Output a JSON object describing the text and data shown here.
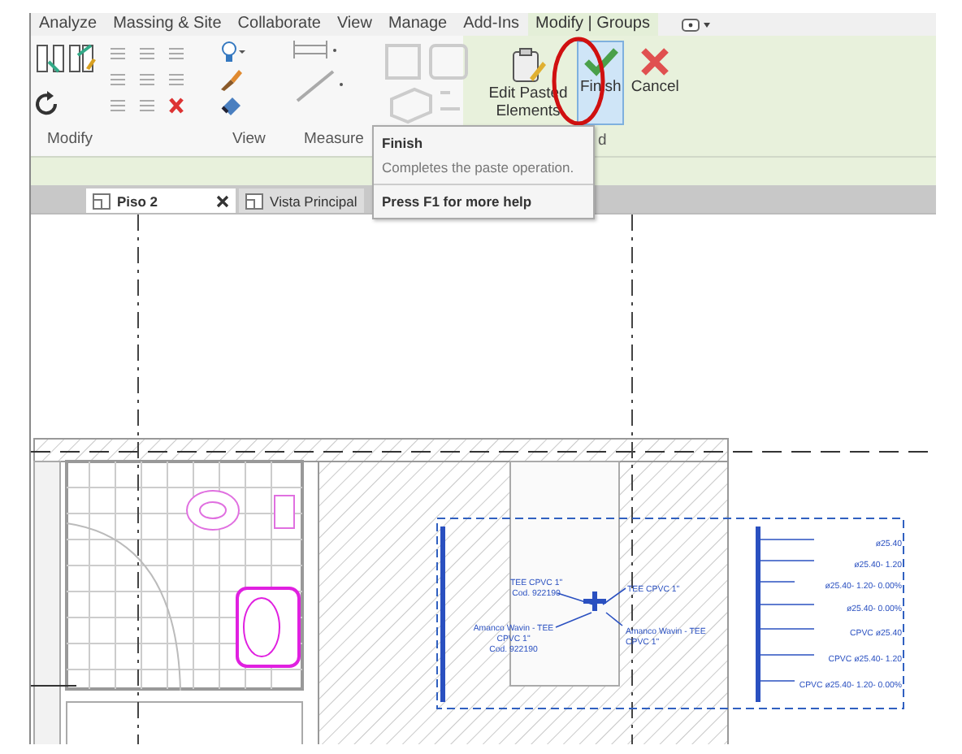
{
  "ribbon_tabs": [
    {
      "label": "Analyze",
      "selected": false
    },
    {
      "label": "Massing & Site",
      "selected": false
    },
    {
      "label": "Collaborate",
      "selected": false
    },
    {
      "label": "View",
      "selected": false
    },
    {
      "label": "Manage",
      "selected": false
    },
    {
      "label": "Add-Ins",
      "selected": false
    },
    {
      "label": "Modify | Groups",
      "selected": true
    }
  ],
  "ribbon_panels": [
    {
      "label": "Modify"
    },
    {
      "label": "View"
    },
    {
      "label": "Measure"
    },
    {
      "label": "d"
    }
  ],
  "buttons": [
    {
      "kind": "edit",
      "label": "Edit Pasted Elements",
      "selected": false
    },
    {
      "kind": "finish",
      "label": "Finish",
      "selected": true
    },
    {
      "kind": "cancel",
      "label": "Cancel",
      "selected": false
    }
  ],
  "tooltip": {
    "title": "Finish",
    "description": "Completes the paste operation.",
    "help": "Press F1 for more help"
  },
  "view_tabs": [
    {
      "label": "Piso 2",
      "selected": true,
      "closable": true
    },
    {
      "label": "Vista Principal",
      "selected": false,
      "closable": false
    }
  ],
  "drawing": {
    "tags": [
      {
        "lines": [
          "TEE CPVC 1\"",
          "Cod. 922190"
        ]
      },
      {
        "lines": [
          "TEE CPVC 1\""
        ]
      },
      {
        "lines": [
          "Amanco Wavin - TEE",
          "CPVC 1\"",
          "Cod. 922190"
        ]
      },
      {
        "lines": [
          "Amanco Wavin - TEE",
          "CPVC 1\""
        ]
      }
    ],
    "legend": [
      "ø25.40",
      "ø25.40- 1.20",
      "ø25.40- 1.20- 0.00%",
      "ø25.40- 0.00%",
      "CPVC ø25.40",
      "CPVC ø25.40- 1.20",
      "CPVC ø25.40- 1.20- 0.00%"
    ]
  }
}
